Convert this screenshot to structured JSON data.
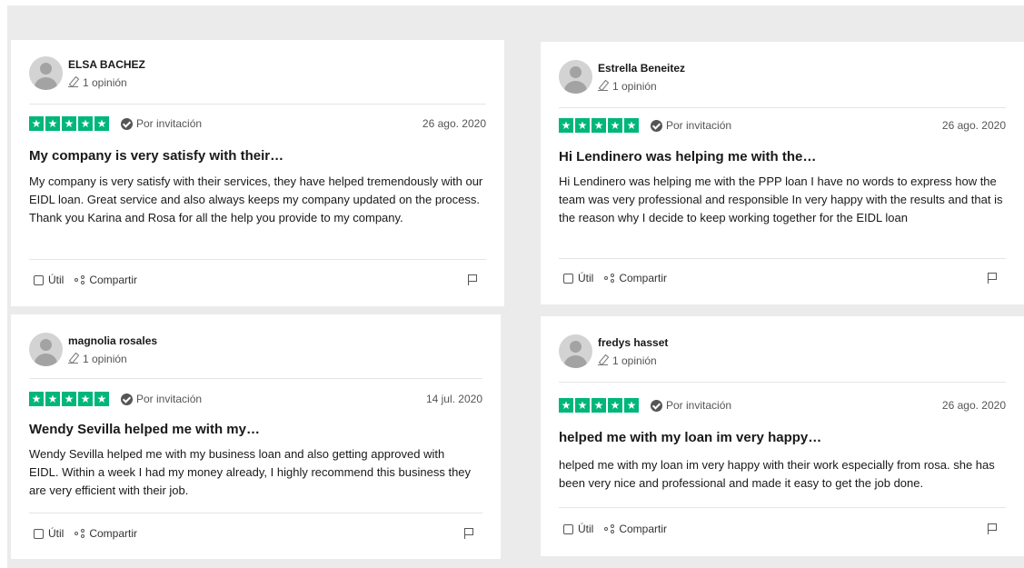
{
  "colors": {
    "star_green": "#00b67a",
    "page_bg": "#ebebeb",
    "card_bg": "#ffffff"
  },
  "common": {
    "verified_label": "Por invitación",
    "helpful_label": "Útil",
    "share_label": "Compartir",
    "star_glyph": "★"
  },
  "reviews": [
    {
      "author": "ELSA BACHEZ",
      "review_count": "1 opinión",
      "stars": 5,
      "date": "26 ago. 2020",
      "title": "My company is very satisfy with their…",
      "text": [
        "My company is very satisfy with their services, they have helped tremendously with our EIDL loan. Great service and also always keeps my company updated on the process.",
        "Thank you Karina and Rosa for all the help you provide to my company."
      ]
    },
    {
      "author": "Estrella Beneitez",
      "review_count": "1 opinión",
      "stars": 5,
      "date": "26 ago. 2020",
      "title": "Hi Lendinero was helping me with the…",
      "text": [
        "Hi Lendinero was helping me with the PPP loan I have no words to express how the team was very professional and responsible In very happy with the results and that is the reason why I decide to keep working together for the EIDL loan"
      ]
    },
    {
      "author": "magnolia rosales",
      "review_count": "1 opinión",
      "stars": 5,
      "date": "14 jul. 2020",
      "title": "Wendy Sevilla helped me with my…",
      "text": [
        "Wendy Sevilla helped me with my business loan and also getting approved with EIDL. Within a week I had my money already, I highly recommend this business they are very efficient with their job."
      ]
    },
    {
      "author": "fredys hasset",
      "review_count": "1 opinión",
      "stars": 5,
      "date": "26 ago. 2020",
      "title": "helped me with my loan im very happy…",
      "text": [
        "helped me with my loan im very happy with their work especially from rosa. she has been very nice and professional and made it easy to get the job done."
      ]
    }
  ]
}
